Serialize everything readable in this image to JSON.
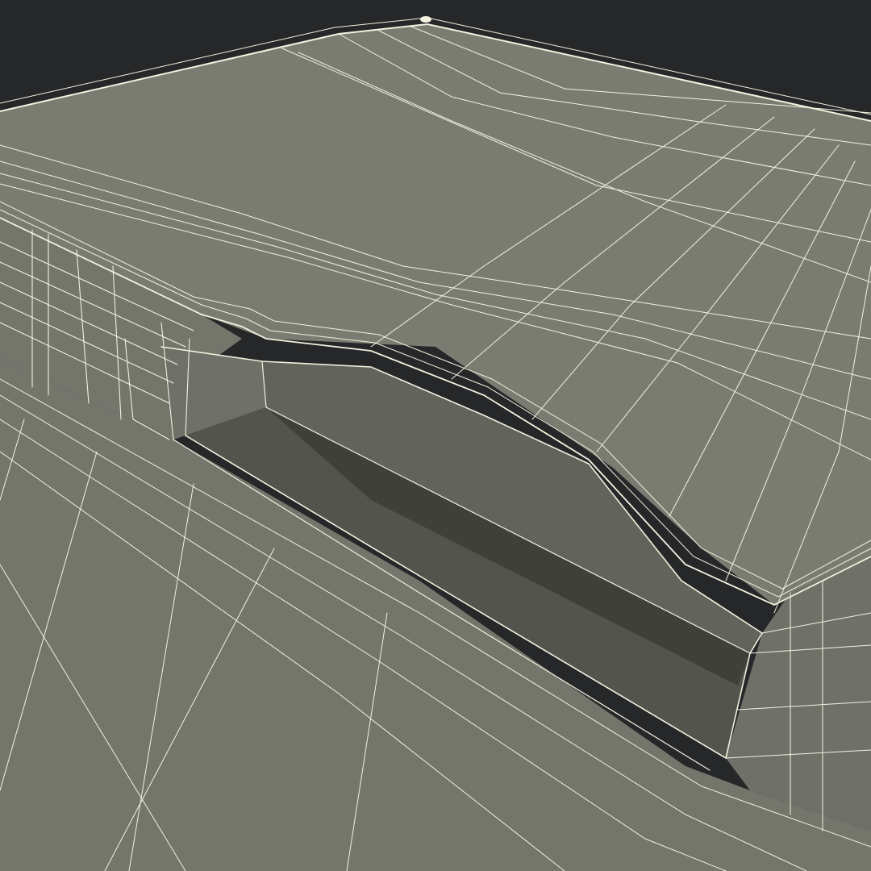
{
  "scene": {
    "subject": "wireframe-render",
    "colors": {
      "background": "#262729",
      "top_face": "#7b7c71",
      "front_face": "#74756b",
      "slot_back_wall": "#62645c",
      "slot_floor": "#52544d",
      "slot_shadow": "#3e4039",
      "end_wall": "#6f7168",
      "wire": "#f3f1df"
    }
  }
}
